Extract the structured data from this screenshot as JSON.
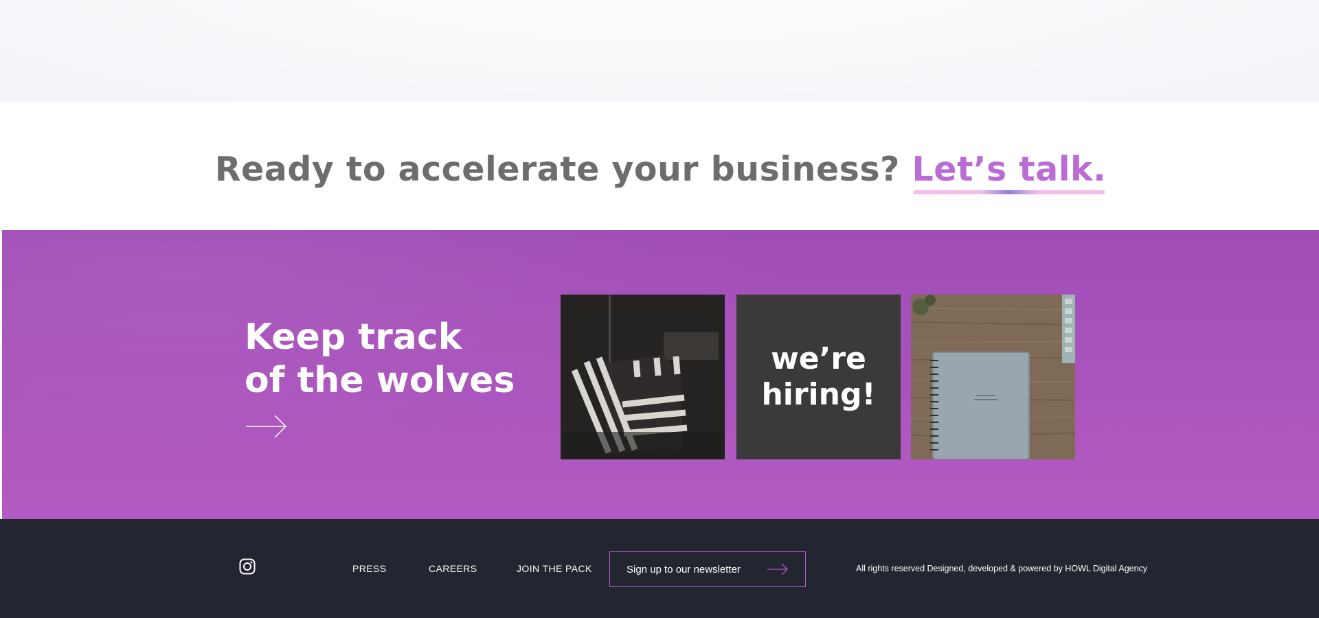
{
  "cta": {
    "question": "Ready to accelerate your business?",
    "link_label": "Let’s talk."
  },
  "wolves": {
    "title_line1": "Keep track",
    "title_line2": "of the wolves",
    "arrow_icon": "arrow-right-icon"
  },
  "tiles": {
    "hiring_text": "we’re\nhiring!"
  },
  "footer": {
    "instagram_icon": "instagram-icon",
    "links": [
      "PRESS",
      "CAREERS",
      "JOIN THE PACK"
    ],
    "newsletter_label": "Sign up to our newsletter",
    "newsletter_icon": "arrow-right-icon",
    "copyright": "All rights reserved Designed, developed & powered by HOWL Digital Agency"
  },
  "colors": {
    "brand_purple": "#a852be",
    "accent_pink": "#bb6bd4",
    "footer_bg": "#232530",
    "heading_gray": "#6d6d6d"
  }
}
